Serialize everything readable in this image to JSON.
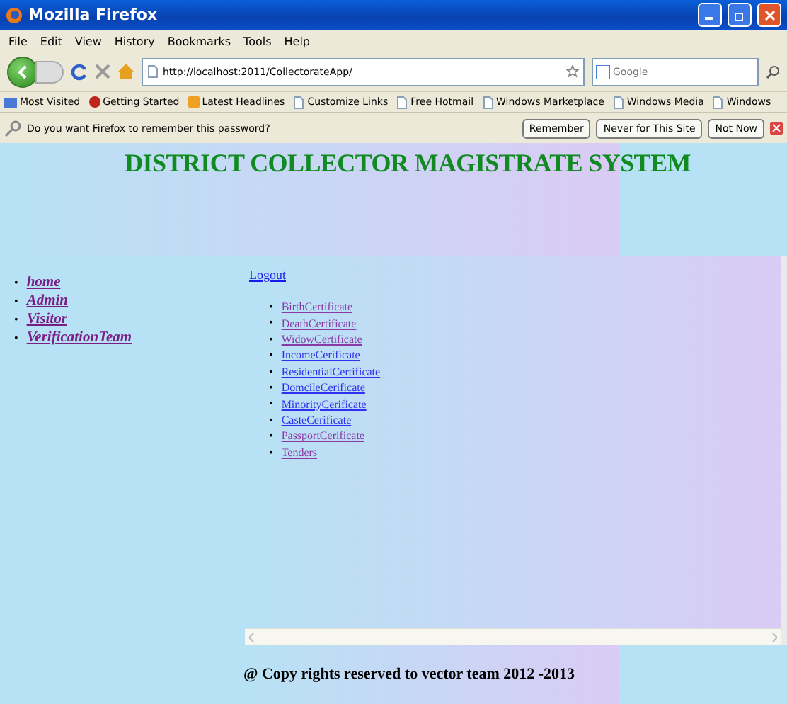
{
  "window": {
    "title": "Mozilla Firefox"
  },
  "menu": [
    "File",
    "Edit",
    "View",
    "History",
    "Bookmarks",
    "Tools",
    "Help"
  ],
  "address": {
    "value": "http://localhost:2011/CollectorateApp/"
  },
  "search": {
    "placeholder": "Google"
  },
  "bookmarks": [
    {
      "label": "Most Visited",
      "kind": "star"
    },
    {
      "label": "Getting Started",
      "kind": "fox"
    },
    {
      "label": "Latest Headlines",
      "kind": "feed"
    },
    {
      "label": "Customize Links",
      "kind": "page"
    },
    {
      "label": "Free Hotmail",
      "kind": "page"
    },
    {
      "label": "Windows Marketplace",
      "kind": "page"
    },
    {
      "label": "Windows Media",
      "kind": "page"
    },
    {
      "label": "Windows",
      "kind": "page"
    }
  ],
  "password_bar": {
    "message": "Do you want Firefox to remember this password?",
    "buttons": [
      "Remember",
      "Never for This Site",
      "Not Now"
    ]
  },
  "page": {
    "heading": "DISTRICT COLLECTOR MAGISTRATE SYSTEM",
    "nav": [
      {
        "label": "home",
        "visited": true
      },
      {
        "label": "Admin",
        "visited": true
      },
      {
        "label": "Visitor",
        "visited": true
      },
      {
        "label": "VerificationTeam",
        "visited": true
      }
    ],
    "logout": "Logout",
    "links": [
      {
        "label": "BirthCertificate",
        "visited": true
      },
      {
        "label": "DeathCertificate",
        "visited": true
      },
      {
        "label": "WidowCertificate",
        "visited": true
      },
      {
        "label": "IncomeCerificate",
        "visited": false
      },
      {
        "label": "ResidentialCertificate",
        "visited": false
      },
      {
        "label": "DomcileCerificate",
        "visited": false
      },
      {
        "label": "MinorityCerificate",
        "visited": false
      },
      {
        "label": "CasteCerificate",
        "visited": false
      },
      {
        "label": "PassportCerificate",
        "visited": true
      },
      {
        "label": "Tenders",
        "visited": true
      }
    ],
    "bullet": "•",
    "footer": "@ Copy rights reserved to vector team 2012 -2013"
  }
}
